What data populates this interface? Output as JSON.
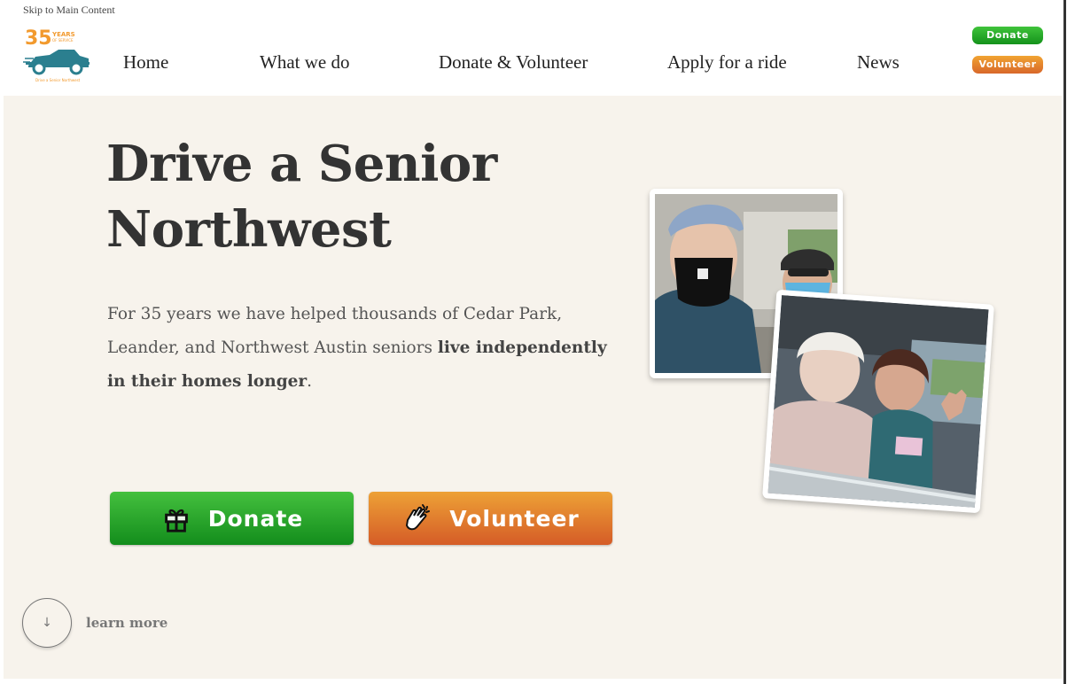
{
  "skip_link": "Skip to Main Content",
  "logo": {
    "top_text": "35",
    "years_text": "YEARS",
    "service_text": "OF SERVICE",
    "org_text": "Drive a Senior Northwest"
  },
  "nav": {
    "items": [
      {
        "label": "Home"
      },
      {
        "label": "What we do"
      },
      {
        "label": "Donate & Volunteer"
      },
      {
        "label": "Apply for a ride"
      },
      {
        "label": "News"
      }
    ]
  },
  "header_buttons": {
    "donate": "Donate",
    "volunteer": "Volunteer"
  },
  "hero": {
    "title_line1": "Drive a Senior",
    "title_line2": "Northwest",
    "text_intro": "For 35 years we have helped thousands of Cedar Park, Leander, and Northwest Austin seniors ",
    "text_bold": "live independently in their homes longer",
    "text_end": ".",
    "donate_label": "Donate",
    "volunteer_label": "Volunteer"
  },
  "learn_more": {
    "arrow": "↓",
    "label": "learn more"
  },
  "colors": {
    "hero_bg": "#f7f3ec",
    "donate_green": "#22a126",
    "volunteer_orange": "#e07e2d",
    "logo_teal": "#2b7f8f",
    "logo_orange": "#f29a2e"
  }
}
